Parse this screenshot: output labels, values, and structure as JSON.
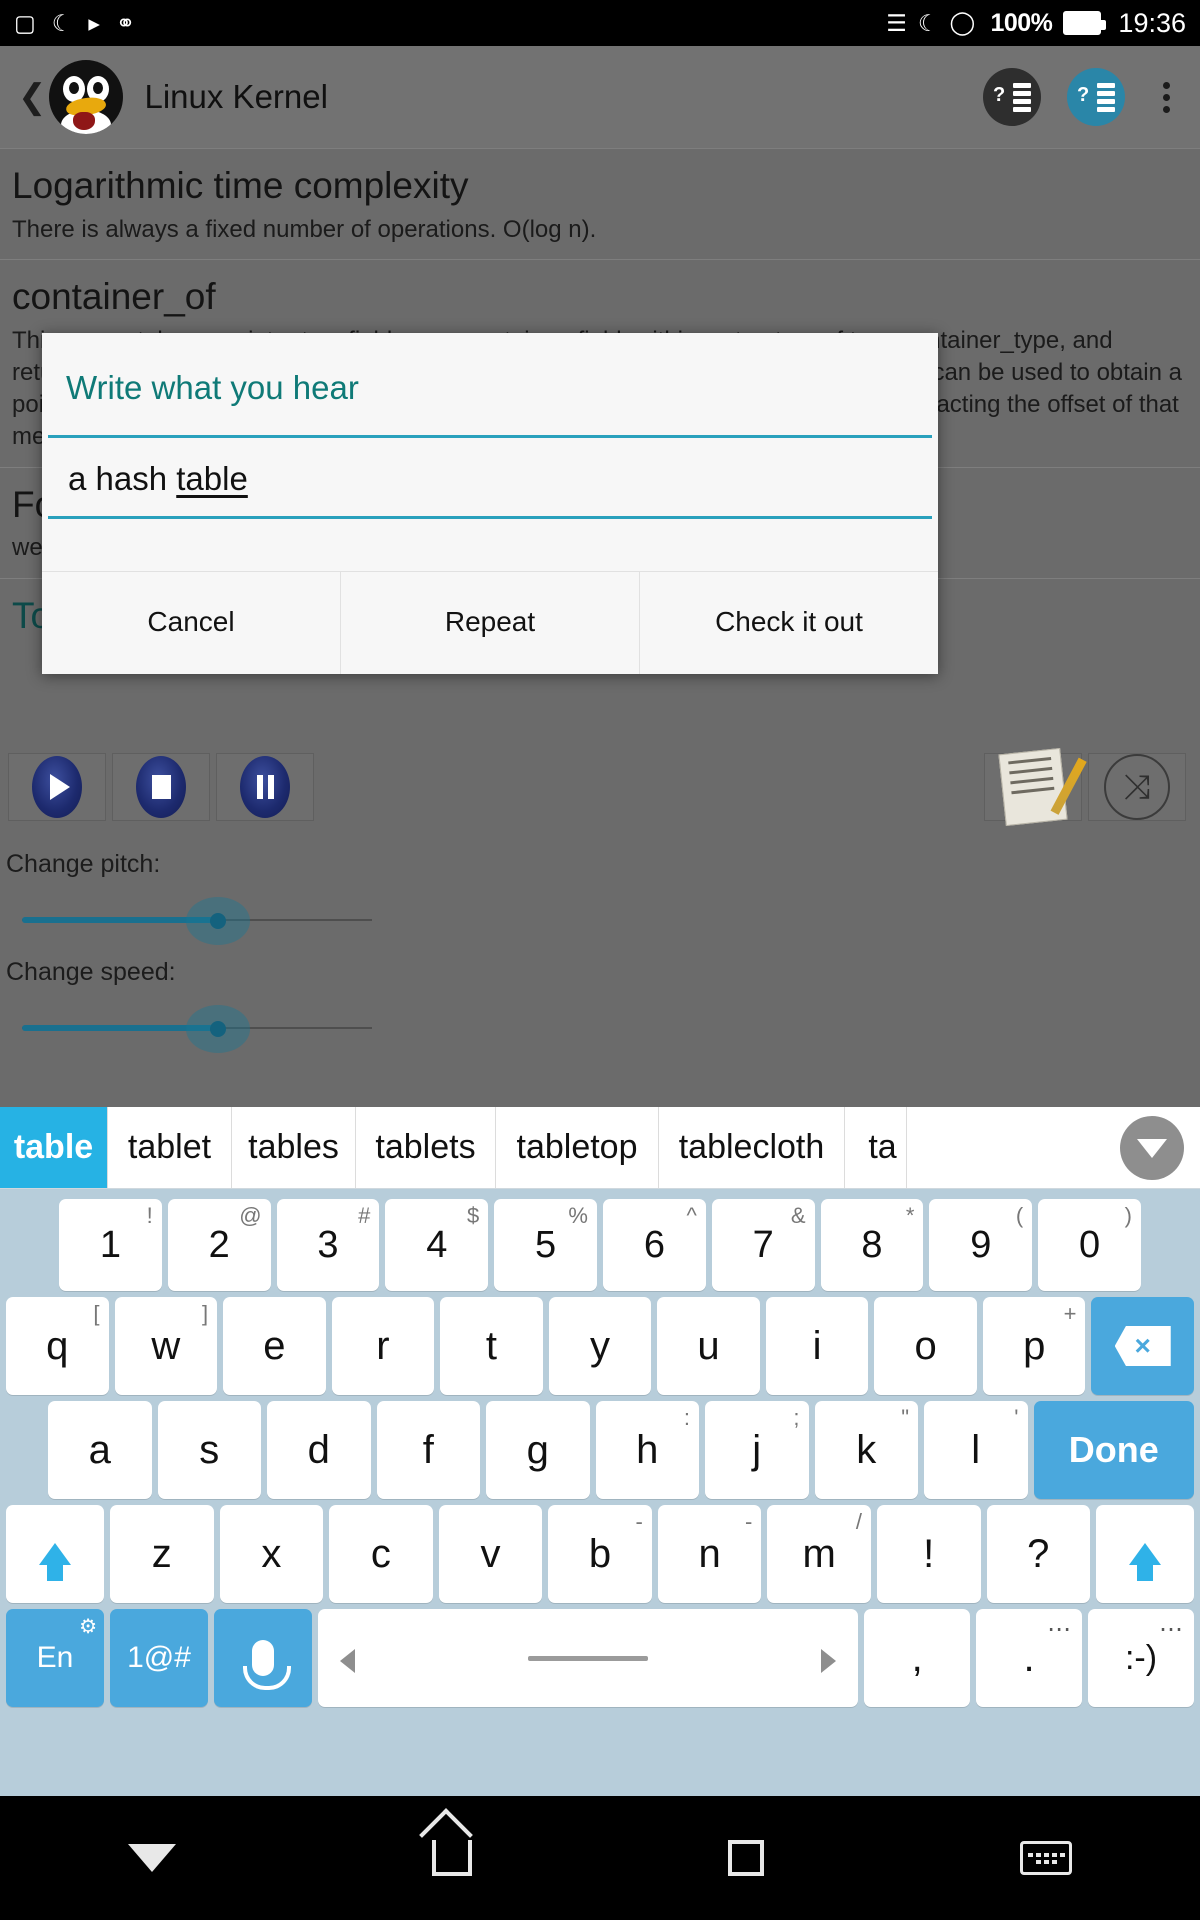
{
  "statusbar": {
    "time": "19:36",
    "battery_percent": "100%",
    "icons_left": [
      "image-icon",
      "moon-icon",
      "play-store-icon",
      "bug-droid-icon"
    ],
    "icons_right": [
      "bluetooth-icon",
      "do-not-disturb-moon-icon",
      "wifi-icon",
      "battery-icon"
    ]
  },
  "actionbar": {
    "title": "Linux Kernel",
    "logo": "tux-penguin-logo",
    "back_icon": "back-caret-icon",
    "action1": "quiz-list-dark-icon",
    "action2": "quiz-list-blue-icon",
    "overflow": "overflow-menu-icon"
  },
  "article": {
    "sections": [
      {
        "heading": "Logarithmic time complexity",
        "body": "There is always a fixed number of operations. O(log n).",
        "teal": false
      },
      {
        "heading": "container_of",
        "body": "This macro takes a pointer to a field name container_field, within a structure of type container_type, and returns a pointer to the containing structure. Simply this is a convenience macro which can be used to obtain a pointer to the containing structure from a pointer to a member of that structure, by subtracting the offset of that member from the member pointer.",
        "teal": false
      },
      {
        "heading": "Fo",
        "body": "we",
        "teal": false
      },
      {
        "heading": "To",
        "body": "",
        "teal": true
      }
    ]
  },
  "media": {
    "play_label": "play-button",
    "stop_label": "stop-button",
    "pause_label": "pause-button",
    "notes_label": "notes-button",
    "shuffle_label": "shuffle-button",
    "shuffle_glyph": "⤨"
  },
  "sliders": [
    {
      "label": "Change pitch:",
      "fill_percent": 56
    },
    {
      "label": "Change speed:",
      "fill_percent": 56
    }
  ],
  "dialog": {
    "title": "Write what you hear",
    "input_prefix": "a hash ",
    "input_underlined": "table",
    "buttons": [
      {
        "label": "Cancel",
        "name": "cancel-button"
      },
      {
        "label": "Repeat",
        "name": "repeat-button"
      },
      {
        "label": "Check it out",
        "name": "check-it-out-button"
      }
    ]
  },
  "suggestions": {
    "items": [
      "table",
      "tablet",
      "tables",
      "tablets",
      "tabletop",
      "tablecloth",
      "ta"
    ],
    "selected_index": 0,
    "expand_icon": "chevron-down-icon"
  },
  "keyboard": {
    "rows": {
      "numbers": [
        {
          "main": "1",
          "alt": "!"
        },
        {
          "main": "2",
          "alt": "@"
        },
        {
          "main": "3",
          "alt": "#"
        },
        {
          "main": "4",
          "alt": "$"
        },
        {
          "main": "5",
          "alt": "%"
        },
        {
          "main": "6",
          "alt": "^"
        },
        {
          "main": "7",
          "alt": "&"
        },
        {
          "main": "8",
          "alt": "*"
        },
        {
          "main": "9",
          "alt": "("
        },
        {
          "main": "0",
          "alt": ")"
        }
      ],
      "top": [
        {
          "main": "q",
          "alt": "["
        },
        {
          "main": "w",
          "alt": "]"
        },
        {
          "main": "e",
          "alt": ""
        },
        {
          "main": "r",
          "alt": ""
        },
        {
          "main": "t",
          "alt": ""
        },
        {
          "main": "y",
          "alt": ""
        },
        {
          "main": "u",
          "alt": ""
        },
        {
          "main": "i",
          "alt": ""
        },
        {
          "main": "o",
          "alt": ""
        },
        {
          "main": "p",
          "alt": "+"
        }
      ],
      "home": [
        {
          "main": "a",
          "alt": ""
        },
        {
          "main": "s",
          "alt": ""
        },
        {
          "main": "d",
          "alt": ""
        },
        {
          "main": "f",
          "alt": ""
        },
        {
          "main": "g",
          "alt": ""
        },
        {
          "main": "h",
          "alt": ":"
        },
        {
          "main": "j",
          "alt": ";"
        },
        {
          "main": "k",
          "alt": "\""
        },
        {
          "main": "l",
          "alt": "'"
        }
      ],
      "bottom": [
        {
          "main": "z",
          "alt": ""
        },
        {
          "main": "x",
          "alt": ""
        },
        {
          "main": "c",
          "alt": ""
        },
        {
          "main": "v",
          "alt": ""
        },
        {
          "main": "b",
          "alt": "-"
        },
        {
          "main": "n",
          "alt": "-"
        },
        {
          "main": "m",
          "alt": "/"
        },
        {
          "main": "!",
          "alt": ""
        },
        {
          "main": "?",
          "alt": ""
        }
      ]
    },
    "backspace_label": "×",
    "enter_label": "Done",
    "lang_label": "En",
    "symbols_label": "1@#",
    "mic_label": "mic-key",
    "comma_label": ",",
    "period_label": ".",
    "emoji_label": ":-)",
    "shift_label": "shift-key"
  },
  "navbar": {
    "back": "nav-back-icon",
    "home": "nav-home-icon",
    "recents": "nav-recents-icon",
    "keyboard": "nav-keyboard-icon"
  },
  "colors": {
    "accent_teal": "#0f7a77",
    "dialog_underline": "#2aa1bd",
    "suggestion_selected": "#26b2e4",
    "key_blue": "#4aa8dd",
    "keyboard_bg": "#b7cdda",
    "actionbar_bg": "#727272"
  }
}
